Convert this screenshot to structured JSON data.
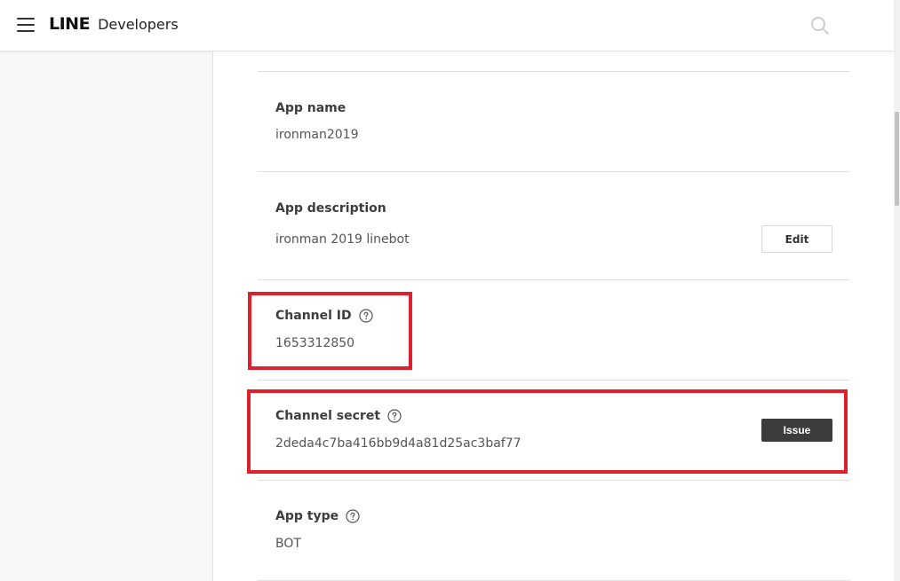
{
  "header": {
    "brand_line": "LINE",
    "brand_developers": "Developers"
  },
  "fields": {
    "app_name": {
      "label": "App name",
      "value": "ironman2019"
    },
    "app_description": {
      "label": "App description",
      "value": "ironman 2019 linebot",
      "action": "Edit"
    },
    "channel_id": {
      "label": "Channel ID",
      "value": "1653312850"
    },
    "channel_secret": {
      "label": "Channel secret",
      "value": "2deda4c7ba416bb9d4a81d25ac3baf77",
      "action": "Issue"
    },
    "app_type": {
      "label": "App type",
      "value": "BOT"
    }
  },
  "colors": {
    "highlight": "#e0202c",
    "issue_button": "#3c3c3c",
    "sidebar": "#f7f7f7"
  },
  "icons": {
    "menu": "hamburger-icon",
    "search": "search-icon",
    "help": "question-circle-icon"
  }
}
